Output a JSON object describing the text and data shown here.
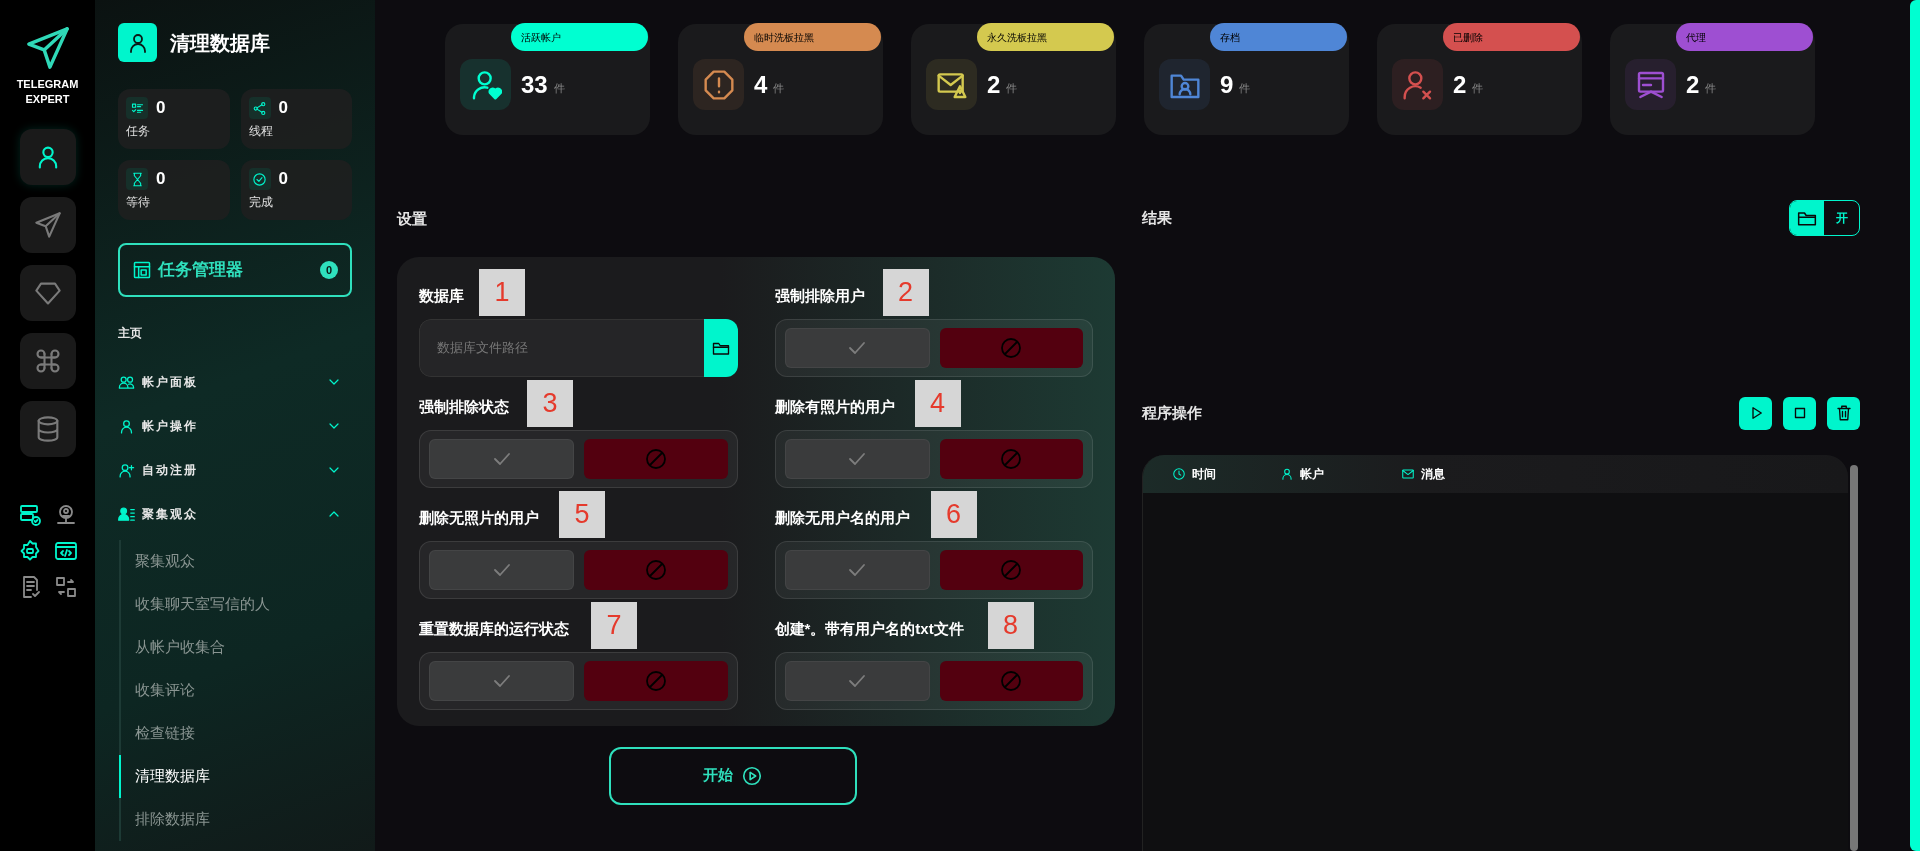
{
  "rail": {
    "logo_lines": [
      "TELEGRAM",
      "EXPERT"
    ],
    "nav": [
      {
        "selected": true
      },
      {
        "selected": false
      },
      {
        "selected": false
      },
      {
        "selected": false
      },
      {
        "selected": false
      }
    ],
    "tools": [
      {
        "highlighted": true
      },
      {
        "highlighted": false
      },
      {
        "highlighted": true
      },
      {
        "highlighted": true
      },
      {
        "highlighted": false
      },
      {
        "highlighted": false
      }
    ]
  },
  "sidebar": {
    "title": "清理数据库",
    "stats": [
      {
        "value": "0",
        "label": "任务"
      },
      {
        "value": "0",
        "label": "线程"
      },
      {
        "value": "0",
        "label": "等待"
      },
      {
        "value": "0",
        "label": "完成"
      }
    ],
    "task_manager": {
      "label": "任务管理器",
      "count": "0"
    },
    "section": "主页",
    "menu": [
      {
        "label": "帐户面板",
        "expanded": false
      },
      {
        "label": "帐户操作",
        "expanded": false
      },
      {
        "label": "自动注册",
        "expanded": false
      },
      {
        "label": "聚集观众",
        "expanded": true,
        "children": [
          {
            "label": "聚集观众",
            "selected": false
          },
          {
            "label": "收集聊天室写信的人",
            "selected": false
          },
          {
            "label": "从帐户收集合",
            "selected": false
          },
          {
            "label": "收集评论",
            "selected": false
          },
          {
            "label": "检查链接",
            "selected": false
          },
          {
            "label": "清理数据库",
            "selected": true
          },
          {
            "label": "排除数据库",
            "selected": false
          }
        ]
      }
    ]
  },
  "stat_cards": [
    {
      "badge": "活跃帐户",
      "color": "#00ffd1",
      "value": "33",
      "unit": "件"
    },
    {
      "badge": "临时洗板拉黑",
      "color": "#d58a50",
      "value": "4",
      "unit": "件"
    },
    {
      "badge": "永久洗板拉黑",
      "color": "#d4c94f",
      "value": "2",
      "unit": "件"
    },
    {
      "badge": "存档",
      "color": "#4f86d6",
      "value": "9",
      "unit": "件"
    },
    {
      "badge": "已删除",
      "color": "#d4504f",
      "value": "2",
      "unit": "件"
    },
    {
      "badge": "代理",
      "color": "#9e4fd2",
      "value": "2",
      "unit": "件"
    }
  ],
  "settings": {
    "title": "设置",
    "database": {
      "label": "数据库",
      "placeholder": "数据库文件路径",
      "marker": "1"
    },
    "toggles": [
      {
        "label": "强制排除用户",
        "on": false,
        "marker": "2"
      },
      {
        "label": "强制排除状态",
        "on": false,
        "marker": "3"
      },
      {
        "label": "删除有照片的用户",
        "on": false,
        "marker": "4"
      },
      {
        "label": "删除无照片的用户",
        "on": false,
        "marker": "5"
      },
      {
        "label": "删除无用户名的用户",
        "on": false,
        "marker": "6"
      },
      {
        "label": "重置数据库的运行状态",
        "on": false,
        "marker": "7"
      },
      {
        "label": "创建*。带有用户名的txt文件",
        "on": false,
        "marker": "8"
      }
    ],
    "start_button": "开始"
  },
  "results": {
    "title": "结果",
    "open_button": "开"
  },
  "operations": {
    "title": "程序操作",
    "columns": [
      "时间",
      "帐户",
      "消息"
    ]
  }
}
